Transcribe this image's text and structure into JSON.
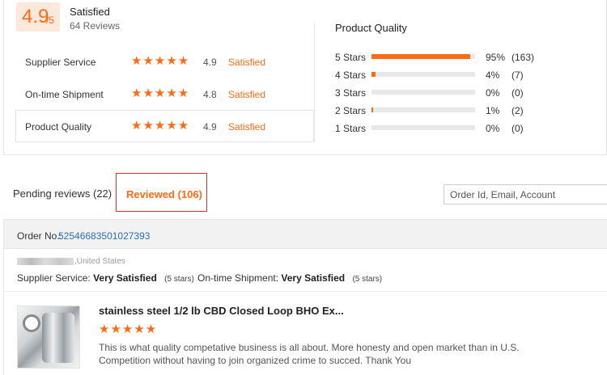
{
  "summary": {
    "score": "4.9",
    "score_suffix": "/5",
    "title": "Satisfied",
    "reviews": "64 Reviews"
  },
  "metrics": [
    {
      "label": "Supplier Service",
      "stars": "★★★★★",
      "score": "4.9",
      "status": "Satisfied"
    },
    {
      "label": "On-time Shipment",
      "stars": "★★★★★",
      "score": "4.8",
      "status": "Satisfied"
    },
    {
      "label": "Product Quality",
      "stars": "★★★★★",
      "score": "4.9",
      "status": "Satisfied"
    }
  ],
  "product_quality": {
    "title": "Product Quality",
    "rows": [
      {
        "label": "5 Stars",
        "percent": "95%",
        "count": "(163)",
        "fill": 0.95
      },
      {
        "label": "4 Stars",
        "percent": "4%",
        "count": "(7)",
        "fill": 0.04
      },
      {
        "label": "3 Stars",
        "percent": "0%",
        "count": "(0)",
        "fill": 0
      },
      {
        "label": "2 Stars",
        "percent": "1%",
        "count": "(2)",
        "fill": 0.01
      },
      {
        "label": "1 Stars",
        "percent": "0%",
        "count": "(0)",
        "fill": 0
      }
    ]
  },
  "tabs": {
    "pending": "Pending reviews (22)",
    "reviewed": "Reviewed (106)"
  },
  "search": {
    "placeholder": "Order Id, Email, Account"
  },
  "order": {
    "label": "Order No.:",
    "number": "52546683501027393",
    "buyer_location": ",United States",
    "supplier_label": "Supplier Service:",
    "supplier_value": "Very Satisfied",
    "supplier_stars": "(5 stars)",
    "ontime_label": "On-time Shipment:",
    "ontime_value": "Very Satisfied",
    "ontime_stars": "(5 stars)",
    "product_title": "stainless steel 1/2 lb CBD Closed Loop BHO Ex...",
    "product_stars": "★★★★★",
    "review_text": "This is what quality competative business is all about. More honesty and open market than in U.S.  Competition without having to join organized crime to succed. Thank You"
  },
  "colors": {
    "accent": "#ff6a14",
    "link": "#2a6fb5",
    "highlight_border": "#d93025"
  }
}
